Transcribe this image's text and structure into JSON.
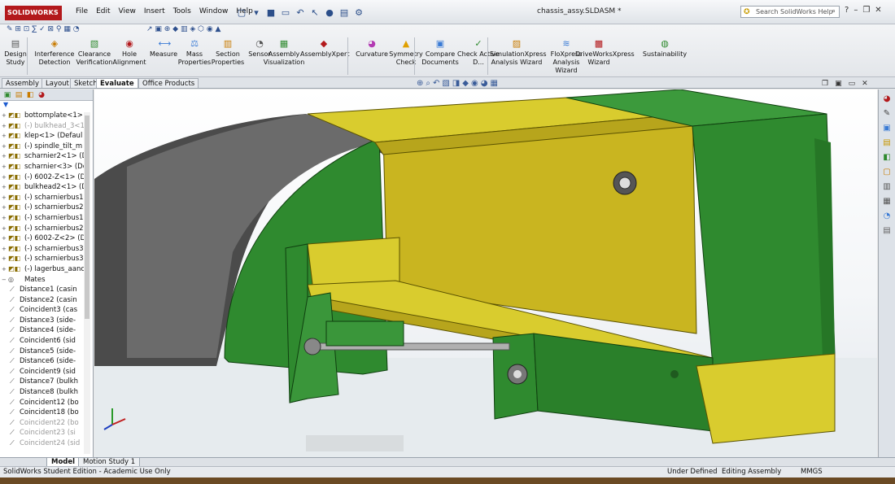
{
  "app": {
    "logo_text": "SOLIDWORKS",
    "document_title": "chassis_assy.SLDASM *",
    "menu": [
      "File",
      "Edit",
      "View",
      "Insert",
      "Tools",
      "Window",
      "Help"
    ],
    "search_placeholder": "Search SolidWorks Help"
  },
  "toolbar": {
    "tools": [
      {
        "label": "Design Study",
        "icon": "design-study-icon"
      },
      {
        "label": "Interference Detection",
        "icon": "interference-icon"
      },
      {
        "label": "Clearance Verification",
        "icon": "clearance-icon"
      },
      {
        "label": "Hole Alignment",
        "icon": "hole-icon"
      },
      {
        "label": "Measure",
        "icon": "measure-icon"
      },
      {
        "label": "Mass Properties",
        "icon": "mass-icon"
      },
      {
        "label": "Section Properties",
        "icon": "section-icon"
      },
      {
        "label": "Sensor",
        "icon": "sensor-icon"
      },
      {
        "label": "Assembly Visualization",
        "icon": "assembly-viz-icon"
      },
      {
        "label": "AssemblyXpert",
        "icon": "assemblyxpert-icon"
      },
      {
        "label": "Curvature",
        "icon": "curvature-icon"
      },
      {
        "label": "Symmetry Check",
        "icon": "symmetry-icon"
      },
      {
        "label": "Compare Documents",
        "icon": "compare-icon"
      },
      {
        "label": "Check Active D...",
        "icon": "check-icon"
      },
      {
        "label": "SimulationXpress Analysis Wizard",
        "icon": "simulation-icon"
      },
      {
        "label": "FloXpress Analysis Wizard",
        "icon": "flo-icon"
      },
      {
        "label": "DriveWorksXpress Wizard",
        "icon": "driveworks-icon"
      },
      {
        "label": "Sustainability",
        "icon": "sustainability-icon"
      }
    ]
  },
  "tabs": [
    "Assembly",
    "Layout",
    "Sketch",
    "Evaluate",
    "Office Products"
  ],
  "active_tab": "Evaluate",
  "tree": {
    "items": [
      {
        "expand": "+",
        "label": "bottomplate<1>",
        "dim": false
      },
      {
        "expand": "+",
        "label": "(-) bulkhead_3<1>",
        "dim": true
      },
      {
        "expand": "+",
        "label": "klep<1> (Defaul",
        "dim": false
      },
      {
        "expand": "+",
        "label": "(-) spindle_tilt_m",
        "dim": false
      },
      {
        "expand": "+",
        "label": "scharnier2<1> (D",
        "dim": false
      },
      {
        "expand": "+",
        "label": "scharnier<3> (De",
        "dim": false
      },
      {
        "expand": "+",
        "label": "(-) 6002-Z<1> (D",
        "dim": false
      },
      {
        "expand": "+",
        "label": "bulkhead2<1> (D",
        "dim": false
      },
      {
        "expand": "+",
        "label": "(-) scharnierbus1",
        "dim": false
      },
      {
        "expand": "+",
        "label": "(-) scharnierbus2",
        "dim": false
      },
      {
        "expand": "+",
        "label": "(-) scharnierbus1",
        "dim": false
      },
      {
        "expand": "+",
        "label": "(-) scharnierbus2",
        "dim": false
      },
      {
        "expand": "+",
        "label": "(-) 6002-Z<2> (D",
        "dim": false
      },
      {
        "expand": "+",
        "label": "(-) scharnierbus3",
        "dim": false
      },
      {
        "expand": "+",
        "label": "(-) scharnierbus3",
        "dim": false
      },
      {
        "expand": "+",
        "label": "(-) lagerbus_aanc",
        "dim": false
      }
    ],
    "mates_label": "Mates",
    "mates": [
      {
        "label": "Distance1 (casin",
        "dim": false
      },
      {
        "label": "Distance2 (casin",
        "dim": false
      },
      {
        "label": "Coincident3 (cas",
        "dim": false
      },
      {
        "label": "Distance3 (side-",
        "dim": false
      },
      {
        "label": "Distance4 (side-",
        "dim": false
      },
      {
        "label": "Coincident6 (sid",
        "dim": false
      },
      {
        "label": "Distance5 (side-",
        "dim": false
      },
      {
        "label": "Distance6 (side-",
        "dim": false
      },
      {
        "label": "Coincident9 (sid",
        "dim": false
      },
      {
        "label": "Distance7 (bulkh",
        "dim": false
      },
      {
        "label": "Distance8 (bulkh",
        "dim": false
      },
      {
        "label": "Coincident12 (bo",
        "dim": false
      },
      {
        "label": "Coincident18 (bo",
        "dim": false
      },
      {
        "label": "Coincident22 (bo",
        "dim": true
      },
      {
        "label": "Coincident23 (si",
        "dim": true
      },
      {
        "label": "Coincident24 (sid",
        "dim": true
      }
    ]
  },
  "bottom_tabs": [
    "Model",
    "Motion Study 1"
  ],
  "active_bottom_tab": "Model",
  "status": {
    "edition": "SolidWorks Student Edition - Academic Use Only",
    "state": "Under Defined",
    "mode": "Editing Assembly",
    "units": "MMGS"
  },
  "colors": {
    "green_part": "#2f8a2f",
    "yellow_part": "#d8cc2a",
    "logo_red": "#b3191c"
  }
}
